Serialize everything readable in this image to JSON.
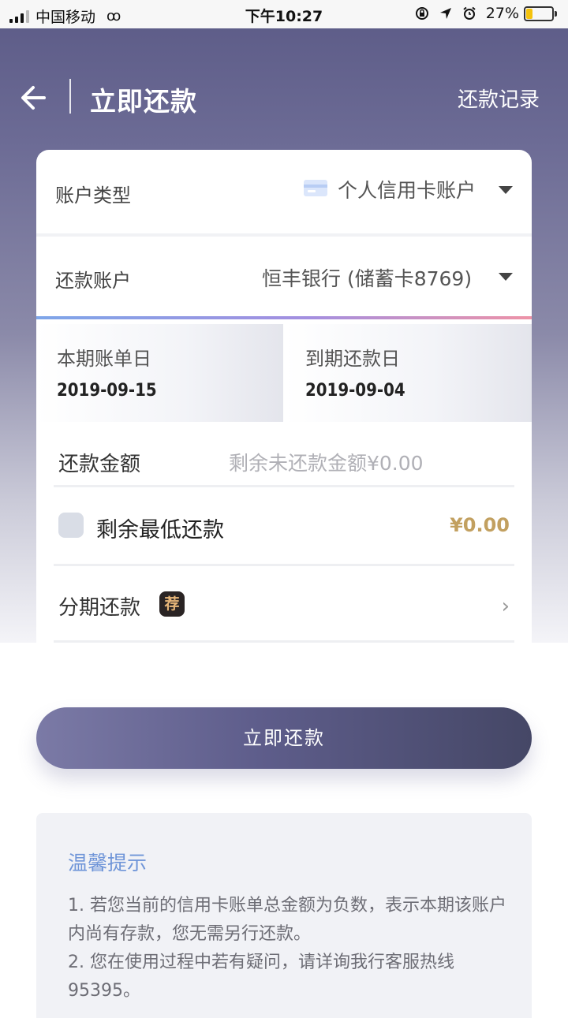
{
  "status_bar": {
    "carrier": "中国移动",
    "time": "下午10:27",
    "battery": "27%",
    "battery_level": 0.27
  },
  "header": {
    "title": "立即还款",
    "records_link": "还款记录"
  },
  "account_type": {
    "label": "账户类型",
    "value": "个人信用卡账户"
  },
  "repay_account": {
    "label": "还款账户",
    "value": "恒丰银行 (储蓄卡8769)"
  },
  "statement": {
    "bill_date_label": "本期账单日",
    "bill_date": "2019-09-15",
    "due_date_label": "到期还款日",
    "due_date": "2019-09-04"
  },
  "amount": {
    "label": "还款金额",
    "placeholder": "剩余未还款金额¥0.00"
  },
  "min_payment": {
    "label": "剩余最低还款",
    "value": "¥0.00"
  },
  "installment": {
    "label": "分期还款",
    "badge": "荐"
  },
  "pay_button": {
    "label": "立即还款"
  },
  "tips": {
    "title": "温馨提示",
    "line1": "1.  若您当前的信用卡账单总金额为负数，表示本期该账户内尚有存款，您无需另行还款。",
    "line2": "2.  您在使用过程中若有疑问，请详询我行客服热线95395。"
  },
  "colors": {
    "accent": "#6f95d8",
    "gold": "#c2a060",
    "button_dark": "#454766"
  }
}
